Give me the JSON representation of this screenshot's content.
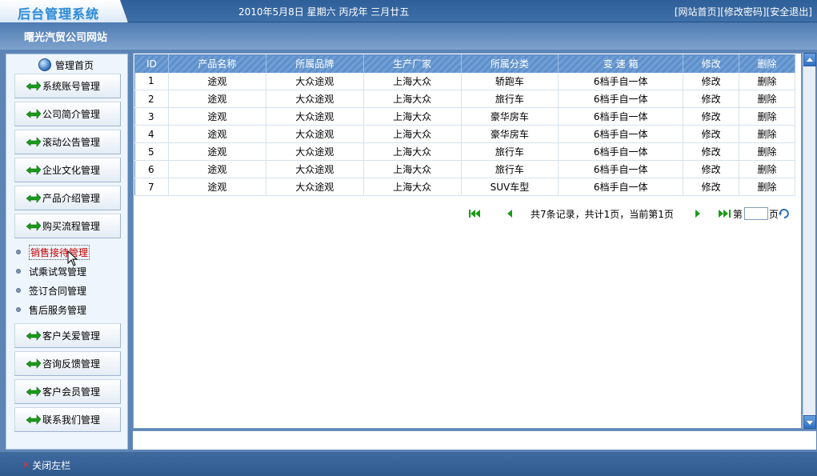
{
  "header": {
    "logo": "后台管理系统",
    "date": "2010年5月8日 星期六 丙戌年 三月廿五",
    "links": [
      "[网站首页]",
      "[修改密码]",
      "[安全退出]"
    ]
  },
  "subheader": {
    "company": "曙光汽贸公司网站"
  },
  "sidebar": {
    "home": "管理首页",
    "menu_top": [
      "系统账号管理",
      "公司简介管理",
      "滚动公告管理",
      "企业文化管理",
      "产品介绍管理",
      "购买流程管理"
    ],
    "submenu": [
      "销售接待管理",
      "试乘试驾管理",
      "签订合同管理",
      "售后服务管理"
    ],
    "menu_bottom": [
      "客户关爱管理",
      "咨询反馈管理",
      "客户会员管理",
      "联系我们管理"
    ]
  },
  "table": {
    "headers": [
      "ID",
      "产品名称",
      "所属品牌",
      "生产厂家",
      "所属分类",
      "变 速 箱",
      "修改",
      "删除"
    ],
    "rows": [
      [
        "1",
        "途观",
        "大众途观",
        "上海大众",
        "轿跑车",
        "6档手自一体",
        "修改",
        "删除"
      ],
      [
        "2",
        "途观",
        "大众途观",
        "上海大众",
        "旅行车",
        "6档手自一体",
        "修改",
        "删除"
      ],
      [
        "3",
        "途观",
        "大众途观",
        "上海大众",
        "豪华房车",
        "6档手自一体",
        "修改",
        "删除"
      ],
      [
        "4",
        "途观",
        "大众途观",
        "上海大众",
        "豪华房车",
        "6档手自一体",
        "修改",
        "删除"
      ],
      [
        "5",
        "途观",
        "大众途观",
        "上海大众",
        "旅行车",
        "6档手自一体",
        "修改",
        "删除"
      ],
      [
        "6",
        "途观",
        "大众途观",
        "上海大众",
        "旅行车",
        "6档手自一体",
        "修改",
        "删除"
      ],
      [
        "7",
        "途观",
        "大众途观",
        "上海大众",
        "SUV车型",
        "6档手自一体",
        "修改",
        "删除"
      ]
    ]
  },
  "pager": {
    "summary": "共7条记录，共计1页，当前第1页",
    "goto_prefix": "第",
    "goto_suffix": "页",
    "page_value": ""
  },
  "footer": {
    "close_left": "关闭左栏"
  },
  "colors": {
    "header_blue": "#2f5f98",
    "accent_green": "#1a9a1a",
    "active_red": "#cc0000"
  }
}
